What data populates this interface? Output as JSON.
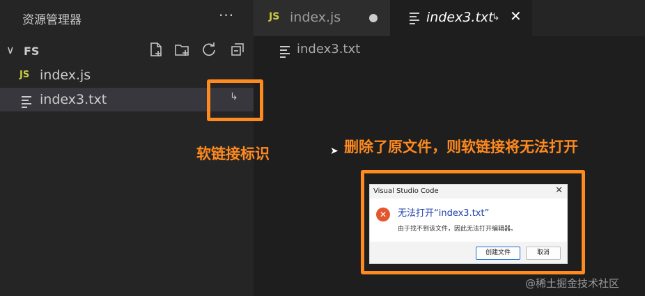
{
  "sidebar": {
    "title": "资源管理器",
    "more": "···",
    "folder": "FS",
    "files": [
      {
        "name": "index.js",
        "badge": "JS"
      },
      {
        "name": "index3.txt"
      }
    ]
  },
  "tabs": [
    {
      "label": "index.js",
      "badge": "JS"
    },
    {
      "label": "index3.txt"
    }
  ],
  "breadcrumb": "index3.txt",
  "annotations": {
    "symlink_label": "软链接标识",
    "note": "删除了原文件，则软链接将无法打开"
  },
  "dialog": {
    "title": "Visual Studio Code",
    "heading": "无法打开“index3.txt”",
    "message": "由于找不到该文件，因此无法打开编辑器。",
    "create_button": "创建文件",
    "cancel_button": "取消"
  },
  "watermark": "@稀土掘金技术社区",
  "colors": {
    "accent": "#ff8a1f",
    "js": "#cbcb41",
    "error": "#e4572e"
  }
}
